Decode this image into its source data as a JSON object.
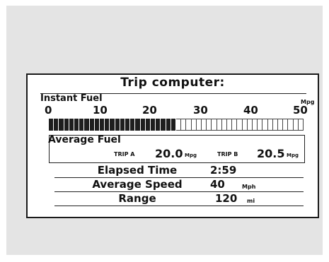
{
  "display": {
    "title": "Trip computer:",
    "instant_fuel": {
      "label": "Instant Fuel",
      "unit": "Mpg",
      "scale_ticks": [
        "0",
        "10",
        "20",
        "30",
        "40",
        "50"
      ],
      "scale_max": 50,
      "value": 25
    },
    "average_fuel": {
      "label": "Average Fuel",
      "trip_a_label": "TRIP A",
      "trip_a_value": "20.0",
      "trip_b_label": "TRIP B",
      "trip_b_value": "20.5",
      "unit": "Mpg"
    },
    "elapsed_time": {
      "label": "Elapsed Time",
      "value": "2:59"
    },
    "average_speed": {
      "label": "Average Speed",
      "value": "40",
      "unit": "Mph"
    },
    "range": {
      "label": "Range",
      "value": "120",
      "unit": "mi"
    }
  },
  "colors": {
    "background_panel": "#e4e4e4",
    "screen": "#ffffff",
    "ink": "#111111"
  }
}
